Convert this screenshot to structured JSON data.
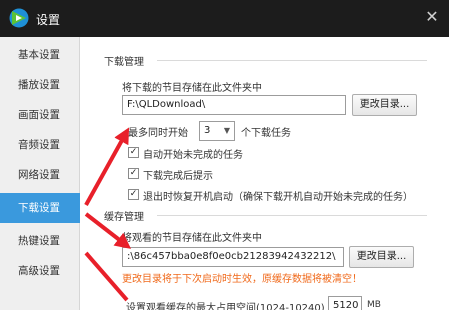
{
  "window": {
    "title": "设置",
    "logo_icon": "app-logo-icon",
    "close_icon": "close-icon",
    "brand_colors": {
      "logo_green": "#5bc236",
      "logo_blue": "#1e90d6",
      "accent": "#3a99dd",
      "warning": "#f06a1c",
      "arrow": "#e8202a"
    }
  },
  "sidebar": {
    "items": [
      {
        "label": "基本设置"
      },
      {
        "label": "播放设置"
      },
      {
        "label": "画面设置"
      },
      {
        "label": "音频设置"
      },
      {
        "label": "网络设置"
      },
      {
        "label": "下载设置",
        "active": true
      },
      {
        "label": "热键设置"
      },
      {
        "label": "高级设置"
      }
    ]
  },
  "download": {
    "section_title": "下载管理",
    "path_label": "将下载的节目存储在此文件夹中",
    "path_value": "F:\\QLDownload\\",
    "change_dir_button": "更改目录...",
    "max_tasks_prefix": "最多同时开始",
    "max_tasks_value": "3",
    "max_tasks_suffix": "个下载任务",
    "options": [
      {
        "label": "自动开始未完成的任务",
        "checked": true
      },
      {
        "label": "下载完成后提示",
        "checked": true
      },
      {
        "label": "退出时恢复开机启动（确保下载开机自动开始未完成的任务）",
        "checked": true
      }
    ]
  },
  "cache": {
    "section_title": "缓存管理",
    "path_label": "将观看的节目存储在此文件夹中",
    "path_value": ":\\86c457bba0e8f0e0cb21283942432212\\",
    "change_dir_button": "更改目录...",
    "warning_text": "更改目录将于下次启动时生效，原缓存数据将被清空！",
    "max_space_label": "设置观看缓存的最大占用空间(1024-10240)",
    "max_space_value": "5120",
    "max_space_unit": "MB"
  }
}
